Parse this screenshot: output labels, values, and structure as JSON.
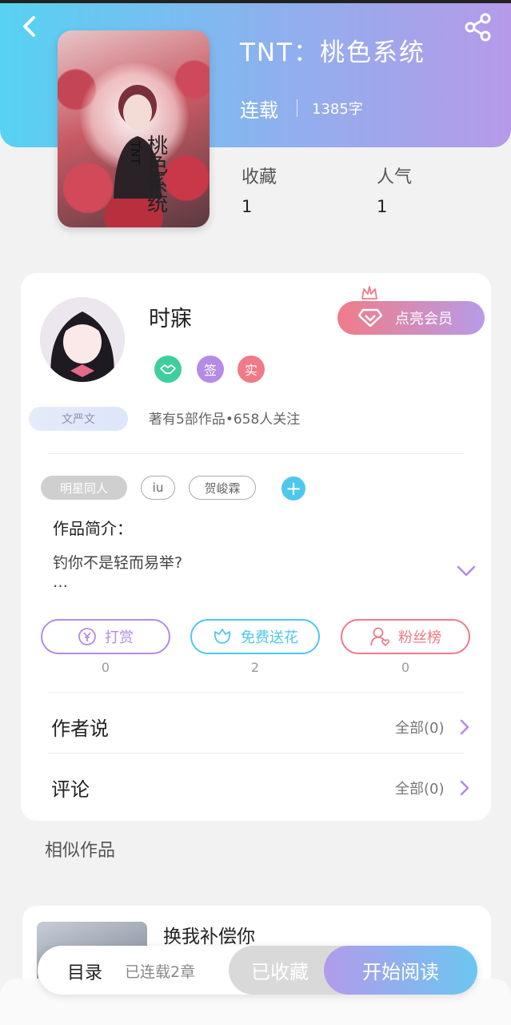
{
  "book": {
    "title": "TNT：桃色系统",
    "status": "连载",
    "word_count": "1385字",
    "cover_text": "桃色系统",
    "cover_tnt": "TNT",
    "stats": [
      {
        "label": "收藏",
        "value": "1"
      },
      {
        "label": "人气",
        "value": "1"
      }
    ]
  },
  "author": {
    "name": "时寐",
    "badges": [
      {
        "icon": "handshake-icon",
        "text": "",
        "color": "#3fcf9e"
      },
      {
        "icon": "",
        "text": "签",
        "color": "#b48be6"
      },
      {
        "icon": "",
        "text": "实",
        "color": "#f07a86"
      }
    ],
    "tag": "文严文",
    "stats": "著有5部作品•658人关注",
    "vip_label": "点亮会员"
  },
  "tags": {
    "items": [
      "明星同人",
      "iu",
      "贺峻霖"
    ]
  },
  "intro": {
    "title": "作品简介：",
    "text": "钓你不是轻而易举?",
    "ellipsis": "…"
  },
  "actions": [
    {
      "label": "打赏",
      "count": "0",
      "icon": "yen-icon",
      "color": "#b48be6"
    },
    {
      "label": "免费送花",
      "count": "2",
      "icon": "flower-icon",
      "color": "#4ec7ee"
    },
    {
      "label": "粉丝榜",
      "count": "0",
      "icon": "fan-user-icon",
      "color": "#f07a86"
    }
  ],
  "sections": [
    {
      "title": "作者说",
      "right": "全部(0)"
    },
    {
      "title": "评论",
      "right": "全部(0)"
    }
  ],
  "similar": {
    "title": "相似作品",
    "book_title": "换我补偿你"
  },
  "bottom": {
    "toc": "目录",
    "chapters": "已连载2章",
    "favorited": "已收藏",
    "start_reading": "开始阅读"
  },
  "colors": {
    "header_start": "#56d2f2",
    "header_end": "#b69ae9",
    "accent_purple": "#b48be6",
    "accent_cyan": "#4ec7ee",
    "accent_pink": "#f07a86"
  }
}
